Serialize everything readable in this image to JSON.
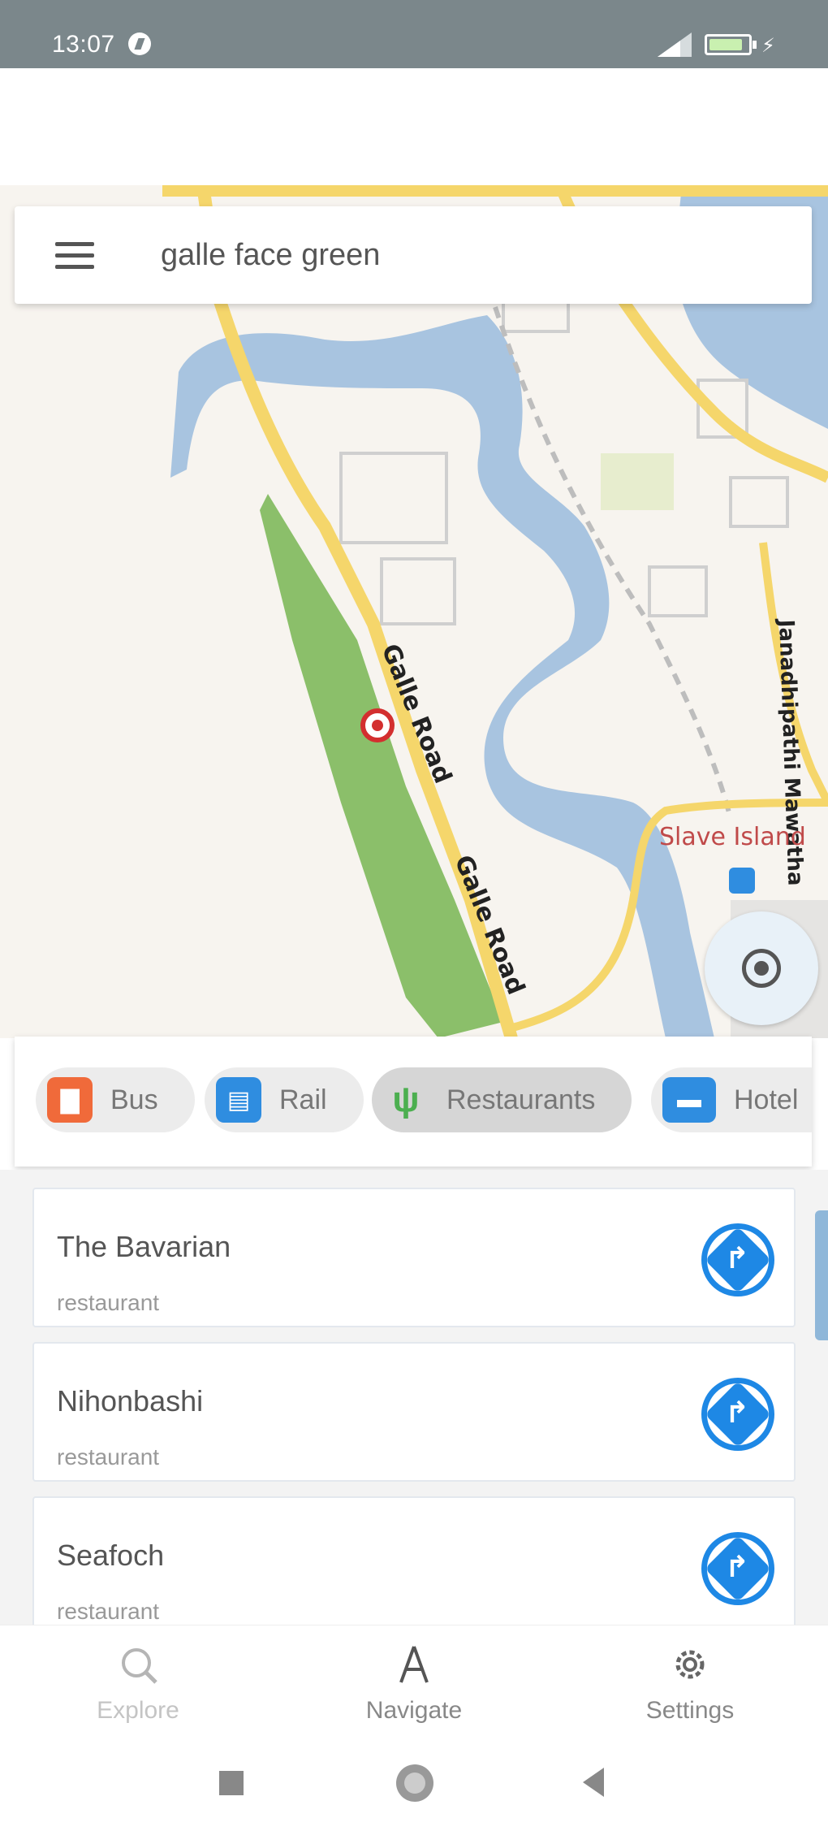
{
  "status_bar": {
    "time": "13:07"
  },
  "search": {
    "value": "galle face green",
    "placeholder": ""
  },
  "map": {
    "road_labels": [
      "Galle Road",
      "Galle Road",
      "Janadhipathi Mawatha"
    ],
    "place_labels": [
      "Slave Island"
    ],
    "colors": {
      "water": "#a8c4e0",
      "park": "#8bbf6a",
      "road": "#f5d66b",
      "land": "#f7f4ef"
    }
  },
  "categories": [
    {
      "label": "Bus",
      "icon": "bus-icon",
      "color": "#f06a3a",
      "selected": false
    },
    {
      "label": "Rail",
      "icon": "rail-icon",
      "color": "#2f8de0",
      "selected": false
    },
    {
      "label": "Restaurants",
      "icon": "fork-knife-icon",
      "color": "#4caf50",
      "selected": true
    },
    {
      "label": "Hotel",
      "icon": "bed-icon",
      "color": "#2f8de0",
      "selected": false
    }
  ],
  "results": [
    {
      "name": "The Bavarian",
      "type": "restaurant"
    },
    {
      "name": "Nihonbashi",
      "type": "restaurant"
    },
    {
      "name": "Seafoch",
      "type": "restaurant"
    }
  ],
  "bottom_nav": {
    "explore": "Explore",
    "navigate": "Navigate",
    "settings": "Settings"
  }
}
